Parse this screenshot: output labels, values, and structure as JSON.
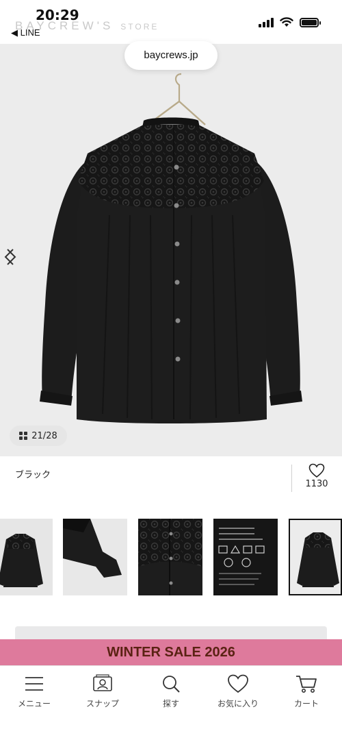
{
  "status_bar": {
    "time": "20:29",
    "back_app": "◀ LINE",
    "brand": "BAYCREW'S",
    "brand_suffix": "STORE"
  },
  "browser": {
    "url": "baycrews.jp"
  },
  "product": {
    "image_counter": "21/28",
    "color_name": "ブラック",
    "favorite_count": "1130"
  },
  "thumbnails": [
    {
      "name": "front-view",
      "active": false
    },
    {
      "name": "sleeve-detail",
      "active": false
    },
    {
      "name": "lace-detail",
      "active": false
    },
    {
      "name": "care-label",
      "active": false
    },
    {
      "name": "back-view",
      "active": true
    }
  ],
  "sale_banner": {
    "label": "WINTER SALE 2026"
  },
  "bottom_nav": {
    "items": [
      {
        "label": "メニュー",
        "icon": "menu-icon"
      },
      {
        "label": "スナップ",
        "icon": "snap-icon"
      },
      {
        "label": "探す",
        "icon": "search-icon"
      },
      {
        "label": "お気に入り",
        "icon": "heart-icon"
      },
      {
        "label": "カート",
        "icon": "cart-icon"
      }
    ]
  },
  "colors": {
    "sale_banner_bg": "#de7a9c",
    "sale_banner_text": "#5a2213",
    "image_bg": "#ececec",
    "garment": "#1b1b1b"
  }
}
